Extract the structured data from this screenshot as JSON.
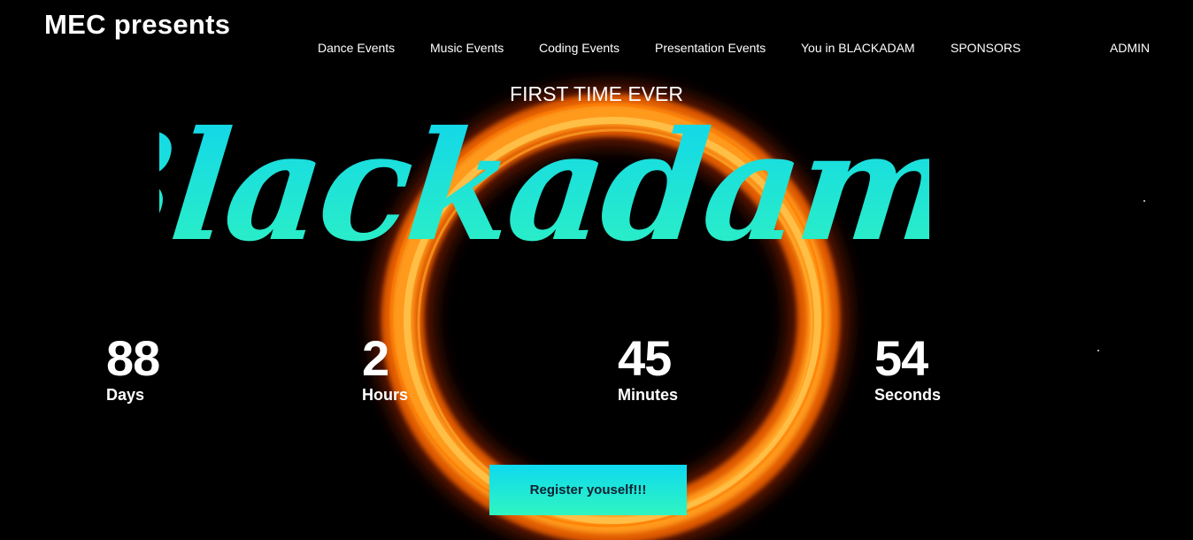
{
  "brand": "MEC presents",
  "nav": [
    {
      "label": "Dance Events"
    },
    {
      "label": "Music Events"
    },
    {
      "label": "Coding Events"
    },
    {
      "label": "Presentation Events"
    },
    {
      "label": "You in BLACKADAM"
    },
    {
      "label": "SPONSORS"
    },
    {
      "label": "ADMIN"
    }
  ],
  "hero": {
    "subtitle": "FIRST TIME EVER",
    "title": "Blackadam!"
  },
  "countdown": [
    {
      "value": "88",
      "unit": "Days"
    },
    {
      "value": "2",
      "unit": "Hours"
    },
    {
      "value": "45",
      "unit": "Minutes"
    },
    {
      "value": "54",
      "unit": "Seconds"
    }
  ],
  "register_label": "Register youself!!!",
  "colors": {
    "background": "#000000",
    "accent_cyan": "#0fd9ef",
    "accent_teal": "#2ef5c0",
    "ring_orange": "#ff8a10"
  }
}
